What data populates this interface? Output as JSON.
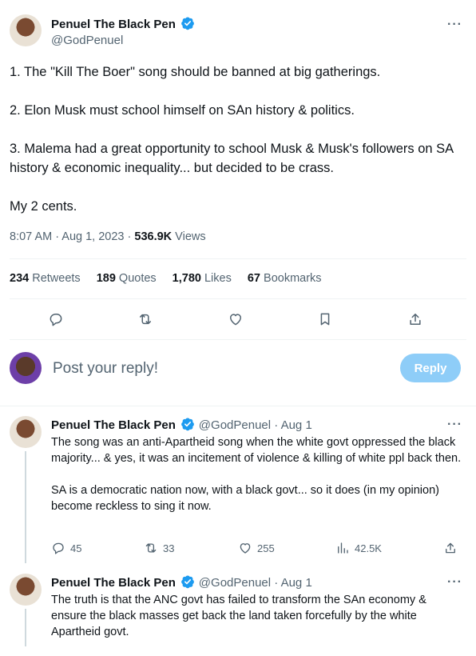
{
  "main_tweet": {
    "author_name": "Penuel The Black Pen",
    "handle": "@GodPenuel",
    "paragraphs": [
      "1. The \"Kill The Boer\" song should be banned at big gatherings.",
      "2. Elon Musk must school himself on SAn history & politics.",
      "3. Malema had a great opportunity to school Musk & Musk's followers on SA history & economic inequality... but decided to be crass.",
      "My 2 cents."
    ],
    "time": "8:07 AM · Aug 1, 2023 · ",
    "views_count": "536.9K",
    "views_label": " Views",
    "stats": {
      "retweets_count": "234",
      "retweets_label": " Retweets",
      "quotes_count": "189",
      "quotes_label": " Quotes",
      "likes_count": "1,780",
      "likes_label": " Likes",
      "bookmarks_count": "67",
      "bookmarks_label": " Bookmarks"
    }
  },
  "reply_box": {
    "placeholder": "Post your reply!",
    "button_label": "Reply"
  },
  "replies": [
    {
      "author_name": "Penuel The Black Pen",
      "handle_date": "@GodPenuel · Aug 1",
      "paragraphs": [
        "The song was an anti-Apartheid song when the white govt oppressed the black majority... & yes, it was an incitement of violence & killing of white ppl back then.",
        "SA is a democratic nation now, with a black govt... so it does (in my opinion) become reckless to sing it now."
      ],
      "replies": "45",
      "retweets": "33",
      "likes": "255",
      "views": "42.5K"
    },
    {
      "author_name": "Penuel The Black Pen",
      "handle_date": "@GodPenuel · Aug 1",
      "paragraphs": [
        "The truth is that the ANC govt has failed to transform the SAn economy & ensure the black masses get back the land taken forcefully by the white Apartheid govt."
      ]
    }
  ],
  "colors": {
    "verified_blue": "#1d9bf0",
    "text_primary": "#0f1419",
    "text_secondary": "#536471",
    "reply_button_bg": "#8ecdf8"
  },
  "icons": [
    "verified-badge-icon",
    "more-icon",
    "reply-icon",
    "retweet-icon",
    "like-icon",
    "bookmark-icon",
    "share-icon",
    "views-icon"
  ]
}
